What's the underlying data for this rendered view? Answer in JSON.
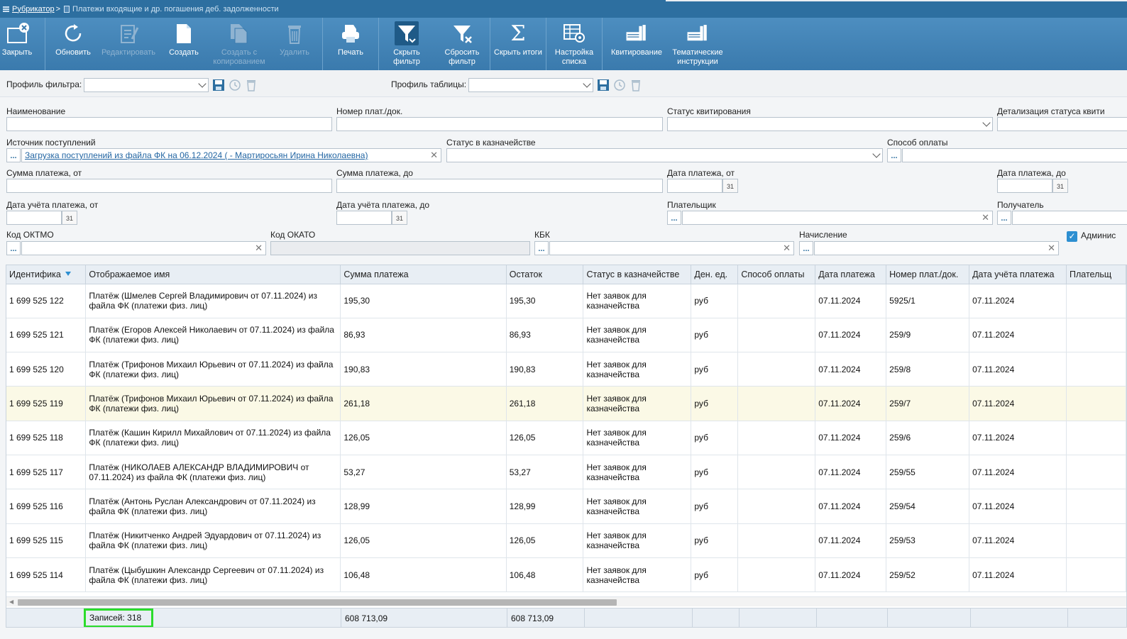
{
  "breadcrumb": {
    "root": "Рубрикатор",
    "separator": ">",
    "current": "Платежи входящие и др. погашения деб. задолженности"
  },
  "toolbar": {
    "close": "Закрыть",
    "refresh": "Обновить",
    "edit": "Редактировать",
    "create": "Создать",
    "create_copy": "Создать с копированием",
    "delete": "Удалить",
    "print": "Печать",
    "hide_filter": "Скрыть фильтр",
    "reset_filter": "Сбросить фильтр",
    "hide_totals": "Скрыть итоги",
    "list_settings": "Настройка списка",
    "reconcile": "Квитирование",
    "thematic": "Тематические инструкции"
  },
  "profiles": {
    "filter_label": "Профиль фильтра:",
    "filter_value": "",
    "table_label": "Профиль таблицы:",
    "table_value": ""
  },
  "filters": {
    "name_label": "Наименование",
    "name_value": "",
    "doc_no_label": "Номер плат./док.",
    "doc_no_value": "",
    "recon_status_label": "Статус квитирования",
    "recon_detail_label": "Детализация статуса квити",
    "source_label": "Источник поступлений",
    "source_value": "Загрузка поступлений из файла ФК на 06.12.2024 ( - Мартиросьян Ирина Николаевна)",
    "treasury_status_label": "Статус в казначействе",
    "pay_method_label": "Способ оплаты",
    "sum_from_label": "Сумма платежа, от",
    "sum_to_label": "Сумма платежа, до",
    "date_from_label": "Дата платежа, от",
    "date_to_label": "Дата платежа, до",
    "acc_date_from_label": "Дата учёта платежа, от",
    "acc_date_to_label": "Дата учёта платежа, до",
    "payer_label": "Плательщик",
    "recipient_label": "Получатель",
    "oktmo_label": "Код ОКТМО",
    "okato_label": "Код ОКАТО",
    "kbk_label": "КБК",
    "accrual_label": "Начисление",
    "admin_label": "Админис",
    "cal_glyph": "31",
    "dots": "...",
    "clear": "✕"
  },
  "table": {
    "columns": [
      "Идентифика",
      "Отображаемое имя",
      "Сумма платежа",
      "Остаток",
      "Статус в казначействе",
      "Ден. ед.",
      "Способ оплаты",
      "Дата платежа",
      "Номер плат./док.",
      "Дата учёта платежа",
      "Плательщ"
    ],
    "rows": [
      {
        "id": "1 699 525 122",
        "name": "Платёж (Шмелев Сергей Владимирович от 07.11.2024) из файла ФК (платежи физ. лиц)",
        "sum": "195,30",
        "rest": "195,30",
        "status": "Нет заявок для казначейства",
        "cur": "руб",
        "method": "",
        "date": "07.11.2024",
        "doc": "5925/1",
        "acc_date": "07.11.2024",
        "payer": ""
      },
      {
        "id": "1 699 525 121",
        "name": "Платёж (Егоров Алексей Николаевич от 07.11.2024) из файла ФК (платежи физ. лиц)",
        "sum": "86,93",
        "rest": "86,93",
        "status": "Нет заявок для казначейства",
        "cur": "руб",
        "method": "",
        "date": "07.11.2024",
        "doc": "259/9",
        "acc_date": "07.11.2024",
        "payer": ""
      },
      {
        "id": "1 699 525 120",
        "name": "Платёж (Трифонов Михаил Юрьевич от 07.11.2024) из файла ФК (платежи физ. лиц)",
        "sum": "190,83",
        "rest": "190,83",
        "status": "Нет заявок для казначейства",
        "cur": "руб",
        "method": "",
        "date": "07.11.2024",
        "doc": "259/8",
        "acc_date": "07.11.2024",
        "payer": ""
      },
      {
        "id": "1 699 525 119",
        "name": "Платёж (Трифонов Михаил Юрьевич от 07.11.2024) из файла ФК (платежи физ. лиц)",
        "sum": "261,18",
        "rest": "261,18",
        "status": "Нет заявок для казначейства",
        "cur": "руб",
        "method": "",
        "date": "07.11.2024",
        "doc": "259/7",
        "acc_date": "07.11.2024",
        "payer": ""
      },
      {
        "id": "1 699 525 118",
        "name": "Платёж (Кашин Кирилл Михайлович от 07.11.2024) из файла ФК (платежи физ. лиц)",
        "sum": "126,05",
        "rest": "126,05",
        "status": "Нет заявок для казначейства",
        "cur": "руб",
        "method": "",
        "date": "07.11.2024",
        "doc": "259/6",
        "acc_date": "07.11.2024",
        "payer": ""
      },
      {
        "id": "1 699 525 117",
        "name": "Платёж (НИКОЛАЕВ АЛЕКСАНДР ВЛАДИМИРОВИЧ от 07.11.2024) из файла ФК (платежи физ. лиц)",
        "sum": "53,27",
        "rest": "53,27",
        "status": "Нет заявок для казначейства",
        "cur": "руб",
        "method": "",
        "date": "07.11.2024",
        "doc": "259/55",
        "acc_date": "07.11.2024",
        "payer": ""
      },
      {
        "id": "1 699 525 116",
        "name": "Платёж (Антонь Руслан Александрович от 07.11.2024) из файла ФК (платежи физ. лиц)",
        "sum": "128,99",
        "rest": "128,99",
        "status": "Нет заявок для казначейства",
        "cur": "руб",
        "method": "",
        "date": "07.11.2024",
        "doc": "259/54",
        "acc_date": "07.11.2024",
        "payer": ""
      },
      {
        "id": "1 699 525 115",
        "name": "Платёж (Никитченко Андрей Эдуардович от 07.11.2024) из файла ФК (платежи физ. лиц)",
        "sum": "126,05",
        "rest": "126,05",
        "status": "Нет заявок для казначейства",
        "cur": "руб",
        "method": "",
        "date": "07.11.2024",
        "doc": "259/53",
        "acc_date": "07.11.2024",
        "payer": ""
      },
      {
        "id": "1 699 525 114",
        "name": "Платёж (Цыбушкин Александр Сергеевич от 07.11.2024) из файла ФК (платежи физ. лиц)",
        "sum": "106,48",
        "rest": "106,48",
        "status": "Нет заявок для казначейства",
        "cur": "руб",
        "method": "",
        "date": "07.11.2024",
        "doc": "259/52",
        "acc_date": "07.11.2024",
        "payer": ""
      }
    ],
    "highlighted_row": 3
  },
  "footer": {
    "records": "Записей: 318",
    "sum_total": "608 713,09",
    "rest_total": "608 713,09"
  },
  "colors": {
    "toolbar": "#3a7aad",
    "header": "#2d6fa0",
    "highlight_row": "#fbf9e6",
    "records_border": "#2bdc2b"
  }
}
